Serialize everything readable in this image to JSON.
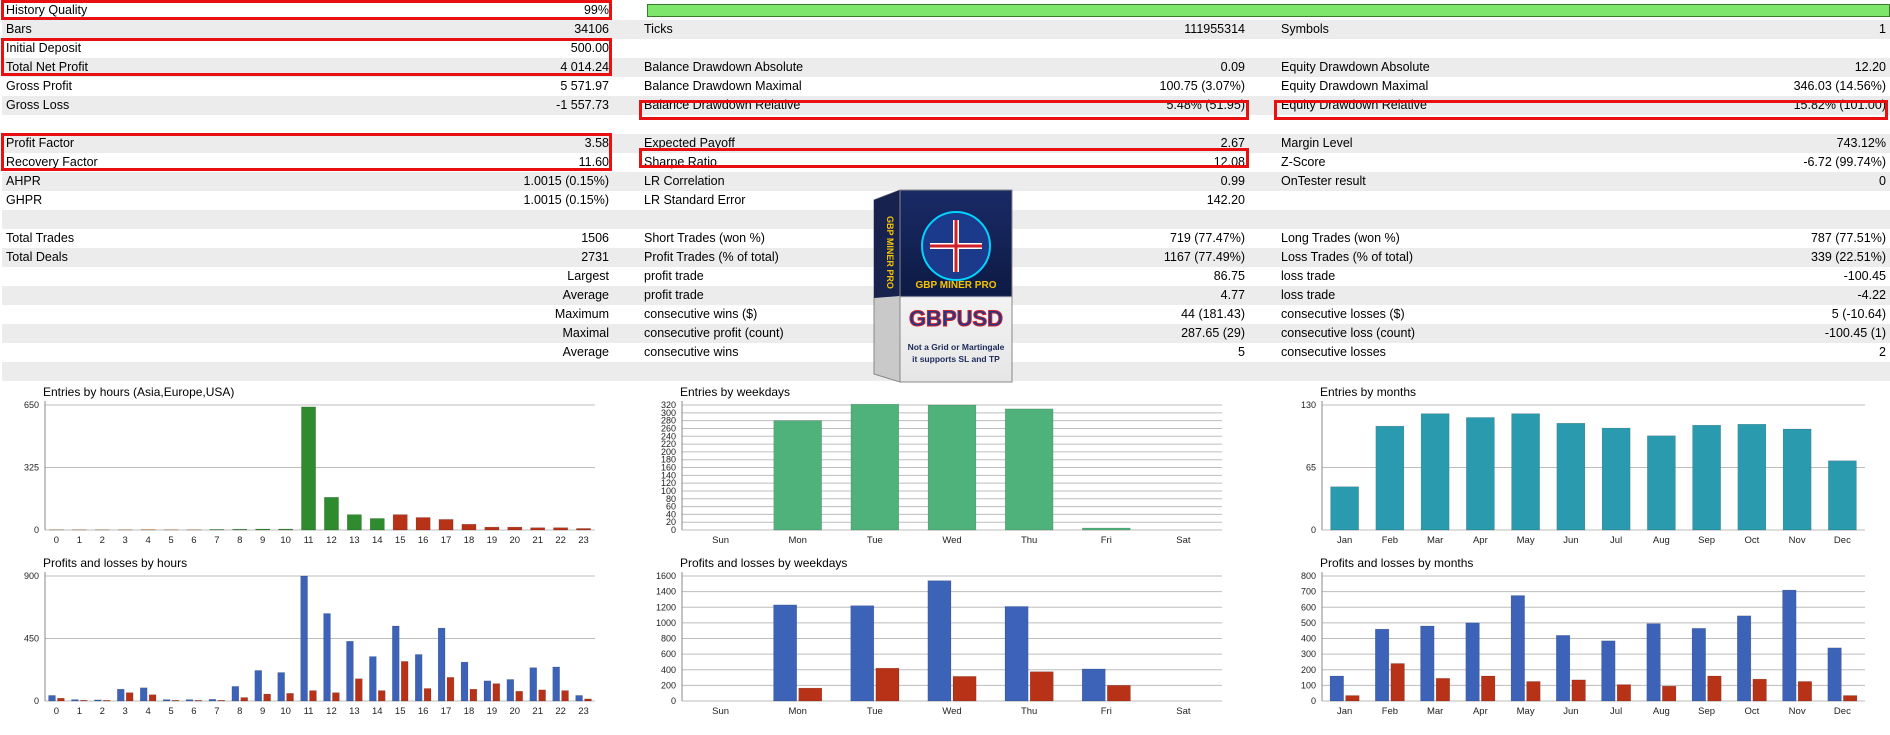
{
  "rows": [
    {
      "cells": [
        {
          "label": "History Quality",
          "value": "99%"
        },
        {
          "label": "",
          "value": ""
        },
        {
          "label": "",
          "value": ""
        }
      ],
      "quality_bar": true
    },
    {
      "cells": [
        {
          "label": "Bars",
          "value": "34106"
        },
        {
          "label": "Ticks",
          "value": "111955314"
        },
        {
          "label": "Symbols",
          "value": "1"
        }
      ]
    },
    {
      "cells": [
        {
          "label": "Initial Deposit",
          "value": "500.00"
        },
        {
          "label": "",
          "value": ""
        },
        {
          "label": "",
          "value": ""
        }
      ]
    },
    {
      "cells": [
        {
          "label": "Total Net Profit",
          "value": "4 014.24"
        },
        {
          "label": "Balance Drawdown Absolute",
          "value": "0.09"
        },
        {
          "label": "Equity Drawdown Absolute",
          "value": "12.20"
        }
      ]
    },
    {
      "cells": [
        {
          "label": "Gross Profit",
          "value": "5 571.97"
        },
        {
          "label": "Balance Drawdown Maximal",
          "value": "100.75 (3.07%)"
        },
        {
          "label": "Equity Drawdown Maximal",
          "value": "346.03 (14.56%)"
        }
      ]
    },
    {
      "cells": [
        {
          "label": "Gross Loss",
          "value": "-1 557.73"
        },
        {
          "label": "Balance Drawdown Relative",
          "value": "5.48% (51.95)"
        },
        {
          "label": "Equity Drawdown Relative",
          "value": "15.82% (101.00)"
        }
      ]
    },
    {
      "cells": [
        {
          "label": "",
          "value": ""
        },
        {
          "label": "",
          "value": ""
        },
        {
          "label": "",
          "value": ""
        }
      ]
    },
    {
      "cells": [
        {
          "label": "Profit Factor",
          "value": "3.58"
        },
        {
          "label": "Expected Payoff",
          "value": "2.67"
        },
        {
          "label": "Margin Level",
          "value": "743.12%"
        }
      ]
    },
    {
      "cells": [
        {
          "label": "Recovery Factor",
          "value": "11.60"
        },
        {
          "label": "Sharpe Ratio",
          "value": "12.08"
        },
        {
          "label": "Z-Score",
          "value": "-6.72 (99.74%)"
        }
      ]
    },
    {
      "cells": [
        {
          "label": "AHPR",
          "value": "1.0015 (0.15%)"
        },
        {
          "label": "LR Correlation",
          "value": "0.99"
        },
        {
          "label": "OnTester result",
          "value": "0"
        }
      ]
    },
    {
      "cells": [
        {
          "label": "GHPR",
          "value": "1.0015 (0.15%)"
        },
        {
          "label": "LR Standard Error",
          "value": "142.20"
        },
        {
          "label": "",
          "value": ""
        }
      ]
    },
    {
      "cells": [
        {
          "label": "",
          "value": ""
        },
        {
          "label": "",
          "value": ""
        },
        {
          "label": "",
          "value": ""
        }
      ]
    },
    {
      "cells": [
        {
          "label": "Total Trades",
          "value": "1506"
        },
        {
          "label": "Short Trades (won %)",
          "value": "719 (77.47%)"
        },
        {
          "label": "Long Trades (won %)",
          "value": "787 (77.51%)"
        }
      ]
    },
    {
      "cells": [
        {
          "label": "Total Deals",
          "value": "2731"
        },
        {
          "label": "Profit Trades (% of total)",
          "value": "1167 (77.49%)"
        },
        {
          "label": "Loss Trades (% of total)",
          "value": "339 (22.51%)"
        }
      ]
    },
    {
      "cells": [
        {
          "label": "",
          "value": "Largest"
        },
        {
          "label": "profit trade",
          "value": "86.75"
        },
        {
          "label": "loss trade",
          "value": "-100.45"
        }
      ]
    },
    {
      "cells": [
        {
          "label": "",
          "value": "Average"
        },
        {
          "label": "profit trade",
          "value": "4.77"
        },
        {
          "label": "loss trade",
          "value": "-4.22"
        }
      ]
    },
    {
      "cells": [
        {
          "label": "",
          "value": "Maximum"
        },
        {
          "label": "consecutive wins ($)",
          "value": "44 (181.43)"
        },
        {
          "label": "consecutive losses ($)",
          "value": "5 (-10.64)"
        }
      ]
    },
    {
      "cells": [
        {
          "label": "",
          "value": "Maximal"
        },
        {
          "label": "consecutive profit (count)",
          "value": "287.65 (29)"
        },
        {
          "label": "consecutive loss (count)",
          "value": "-100.45 (1)"
        }
      ]
    },
    {
      "cells": [
        {
          "label": "",
          "value": "Average"
        },
        {
          "label": "consecutive wins",
          "value": "5"
        },
        {
          "label": "consecutive losses",
          "value": "2"
        }
      ]
    },
    {
      "cells": [
        {
          "label": "",
          "value": ""
        },
        {
          "label": "",
          "value": ""
        },
        {
          "label": "",
          "value": ""
        }
      ]
    }
  ],
  "product_image": {
    "name": "GBP MINER PRO",
    "side_text": "GBP MINER PRO",
    "pair": "GBPUSD",
    "tagline_1": "Not a Grid or Martingale",
    "tagline_2": "it supports SL and TP"
  },
  "colors": {
    "highlight": "#e81010",
    "quality_bar": "#7ee66a",
    "hours_entries_green": "#2e8b2e",
    "entries_orange": "#f7a050",
    "entries_red": "#b83218",
    "weekday_green": "#4fb27a",
    "months_teal": "#2a9aae",
    "profit_blue": "#3c63b8",
    "loss_red": "#b83218"
  },
  "chart_data": [
    {
      "id": "entries-hours",
      "type": "bar",
      "title": "Entries by hours (Asia,Europe,USA)",
      "ylim": [
        0,
        650
      ],
      "yticks": [
        0,
        325,
        650
      ],
      "categories": [
        "0",
        "1",
        "2",
        "3",
        "4",
        "5",
        "6",
        "7",
        "8",
        "9",
        "10",
        "11",
        "12",
        "13",
        "14",
        "15",
        "16",
        "17",
        "18",
        "19",
        "20",
        "21",
        "22",
        "23"
      ],
      "series": [
        {
          "values": [
            2,
            2,
            2,
            2,
            3,
            2,
            2,
            3,
            4,
            5,
            5,
            640,
            170,
            80,
            60,
            80,
            65,
            55,
            30,
            15,
            15,
            12,
            12,
            8
          ]
        }
      ],
      "bar_colors": [
        "#f7a050",
        "#f7a050",
        "#f7a050",
        "#f7a050",
        "#f7a050",
        "#f7a050",
        "#f7a050",
        "#2e8b2e",
        "#2e8b2e",
        "#2e8b2e",
        "#2e8b2e",
        "#2e8b2e",
        "#2e8b2e",
        "#2e8b2e",
        "#2e8b2e",
        "#b83218",
        "#b83218",
        "#b83218",
        "#b83218",
        "#b83218",
        "#b83218",
        "#b83218",
        "#b83218",
        "#b83218"
      ]
    },
    {
      "id": "entries-weekdays",
      "type": "bar",
      "title": "Entries by weekdays",
      "ylim": [
        0,
        320
      ],
      "yticks": [
        0,
        20,
        40,
        60,
        80,
        100,
        120,
        140,
        160,
        180,
        200,
        220,
        240,
        260,
        280,
        300,
        320
      ],
      "categories": [
        "Sun",
        "Mon",
        "Tue",
        "Wed",
        "Thu",
        "Fri",
        "Sat"
      ],
      "series": [
        {
          "values": [
            0,
            280,
            322,
            320,
            310,
            5,
            0
          ]
        }
      ]
    },
    {
      "id": "entries-months",
      "type": "bar",
      "title": "Entries by months",
      "ylim": [
        0,
        130
      ],
      "yticks": [
        0,
        65,
        130
      ],
      "categories": [
        "Jan",
        "Feb",
        "Mar",
        "Apr",
        "May",
        "Jun",
        "Jul",
        "Aug",
        "Sep",
        "Oct",
        "Nov",
        "Dec"
      ],
      "series": [
        {
          "values": [
            45,
            108,
            121,
            117,
            121,
            111,
            106,
            98,
            109,
            110,
            105,
            72
          ]
        }
      ]
    },
    {
      "id": "pl-hours",
      "type": "bar",
      "title": "Profits and losses by hours",
      "ylim": [
        0,
        900
      ],
      "yticks": [
        0,
        450,
        900
      ],
      "categories": [
        "0",
        "1",
        "2",
        "3",
        "4",
        "5",
        "6",
        "7",
        "8",
        "9",
        "10",
        "11",
        "12",
        "13",
        "14",
        "15",
        "16",
        "17",
        "18",
        "19",
        "20",
        "21",
        "22",
        "23"
      ],
      "series": [
        {
          "values": [
            40,
            10,
            8,
            85,
            95,
            10,
            10,
            12,
            105,
            220,
            205,
            900,
            630,
            430,
            320,
            540,
            335,
            525,
            280,
            145,
            155,
            240,
            245,
            40
          ]
        },
        {
          "values": [
            20,
            5,
            5,
            60,
            45,
            5,
            5,
            5,
            25,
            50,
            55,
            75,
            60,
            160,
            75,
            285,
            90,
            170,
            85,
            125,
            70,
            80,
            75,
            15
          ]
        }
      ]
    },
    {
      "id": "pl-weekdays",
      "type": "bar",
      "title": "Profits and losses by weekdays",
      "ylim": [
        0,
        1600
      ],
      "yticks": [
        0,
        200,
        400,
        600,
        800,
        1000,
        1200,
        1400,
        1600
      ],
      "categories": [
        "Sun",
        "Mon",
        "Tue",
        "Wed",
        "Thu",
        "Fri",
        "Sat"
      ],
      "series": [
        {
          "values": [
            0,
            1230,
            1220,
            1540,
            1210,
            410,
            0
          ]
        },
        {
          "values": [
            0,
            165,
            420,
            315,
            375,
            200,
            0
          ]
        }
      ]
    },
    {
      "id": "pl-months",
      "type": "bar",
      "title": "Profits and losses by months",
      "ylim": [
        0,
        800
      ],
      "yticks": [
        0,
        100,
        200,
        300,
        400,
        500,
        600,
        700,
        800
      ],
      "categories": [
        "Jan",
        "Feb",
        "Mar",
        "Apr",
        "May",
        "Jun",
        "Jul",
        "Aug",
        "Sep",
        "Oct",
        "Nov",
        "Dec"
      ],
      "series": [
        {
          "values": [
            160,
            460,
            480,
            500,
            675,
            420,
            385,
            495,
            465,
            545,
            710,
            340
          ]
        },
        {
          "values": [
            35,
            240,
            145,
            160,
            125,
            135,
            105,
            95,
            160,
            140,
            125,
            35
          ]
        }
      ]
    }
  ]
}
